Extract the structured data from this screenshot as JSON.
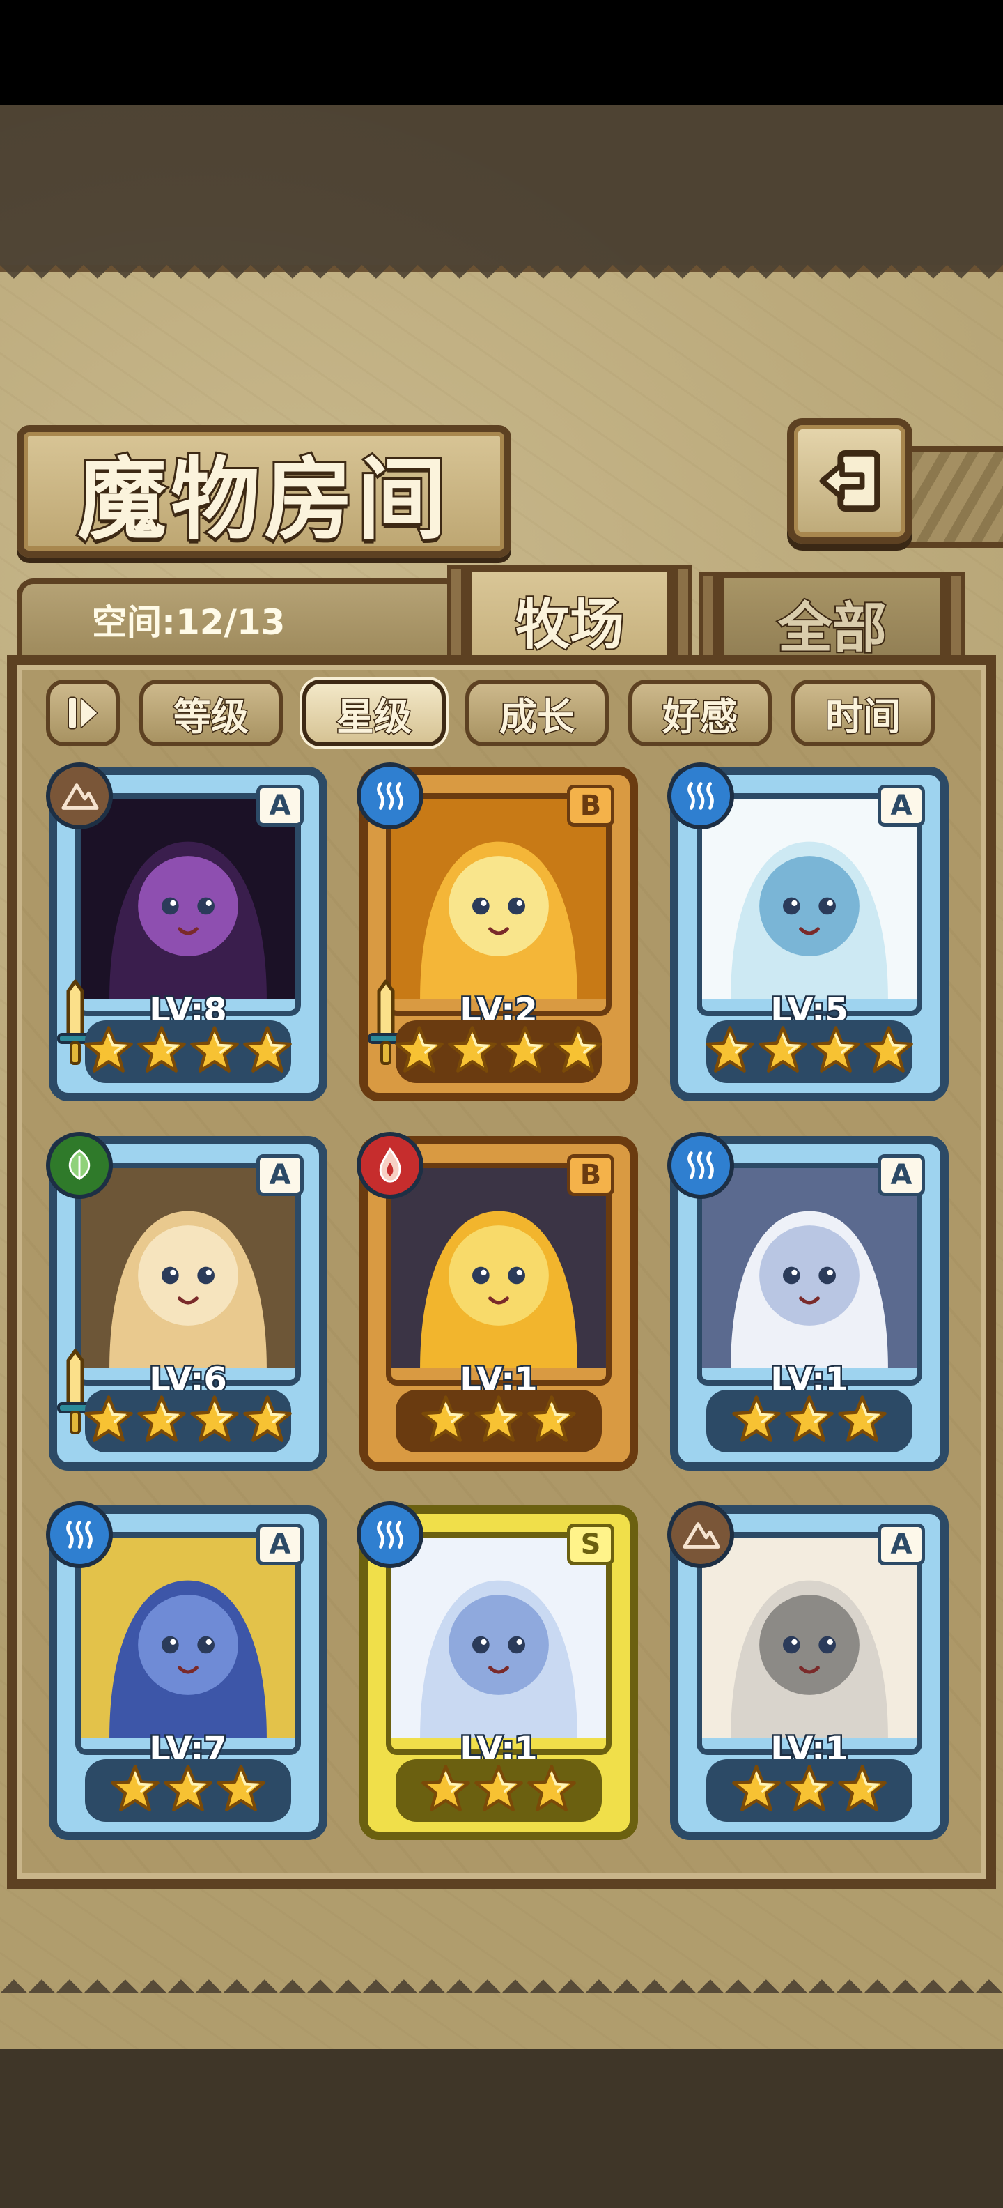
{
  "title": "魔物房间",
  "space_label": "空间:12/13",
  "tabs": {
    "active": "牧场",
    "inactive": "全部"
  },
  "sort_buttons": [
    "等级",
    "星级",
    "成长",
    "好感",
    "时间"
  ],
  "selected_sort": "星级",
  "colors": {
    "earth": "#7a5638",
    "water": "#2f7fd0",
    "leaf": "#2f7a2a",
    "fire": "#c62d2d"
  },
  "monsters": [
    {
      "rank": "A",
      "level": "LV:8",
      "stars": 4,
      "element": "earth-icon",
      "frame": "blue",
      "has_weapon": true
    },
    {
      "rank": "B",
      "level": "LV:2",
      "stars": 4,
      "element": "water-icon",
      "frame": "orange",
      "has_weapon": true
    },
    {
      "rank": "A",
      "level": "LV:5",
      "stars": 4,
      "element": "water-icon",
      "frame": "blue",
      "has_weapon": false
    },
    {
      "rank": "A",
      "level": "LV:6",
      "stars": 4,
      "element": "leaf-icon",
      "frame": "blue",
      "has_weapon": true
    },
    {
      "rank": "B",
      "level": "LV:1",
      "stars": 3,
      "element": "fire-icon",
      "frame": "orange",
      "has_weapon": false
    },
    {
      "rank": "A",
      "level": "LV:1",
      "stars": 3,
      "element": "water-icon",
      "frame": "blue",
      "has_weapon": false
    },
    {
      "rank": "A",
      "level": "LV:7",
      "stars": 3,
      "element": "water-icon",
      "frame": "blue",
      "has_weapon": false
    },
    {
      "rank": "S",
      "level": "LV:1",
      "stars": 3,
      "element": "water-icon",
      "frame": "yellow",
      "has_weapon": false
    },
    {
      "rank": "A",
      "level": "LV:1",
      "stars": 3,
      "element": "earth-icon",
      "frame": "blue",
      "has_weapon": false
    }
  ]
}
